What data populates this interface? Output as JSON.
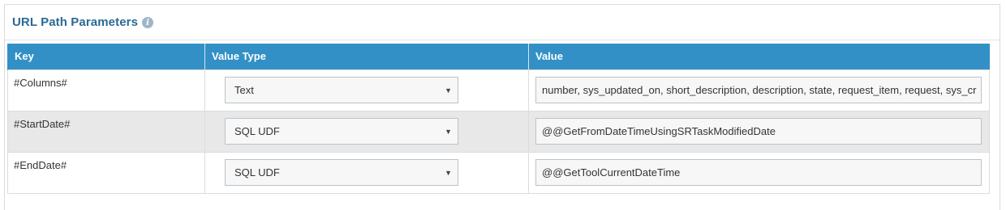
{
  "panel": {
    "title": "URL Path Parameters",
    "info_icon": "info-icon"
  },
  "table": {
    "headers": [
      "Key",
      "Value Type",
      "Value"
    ],
    "rows": [
      {
        "key": "#Columns#",
        "value_type": "Text",
        "value": "number, sys_updated_on, short_description, description, state, request_item, request, sys_cr"
      },
      {
        "key": "#StartDate#",
        "value_type": "SQL UDF",
        "value": "@@GetFromDateTimeUsingSRTaskModifiedDate"
      },
      {
        "key": "#EndDate#",
        "value_type": "SQL UDF",
        "value": "@@GetToolCurrentDateTime"
      }
    ]
  },
  "colors": {
    "header_bg": "#3290c6",
    "title": "#2a6a94",
    "alt_row": "#e8e8e8"
  }
}
